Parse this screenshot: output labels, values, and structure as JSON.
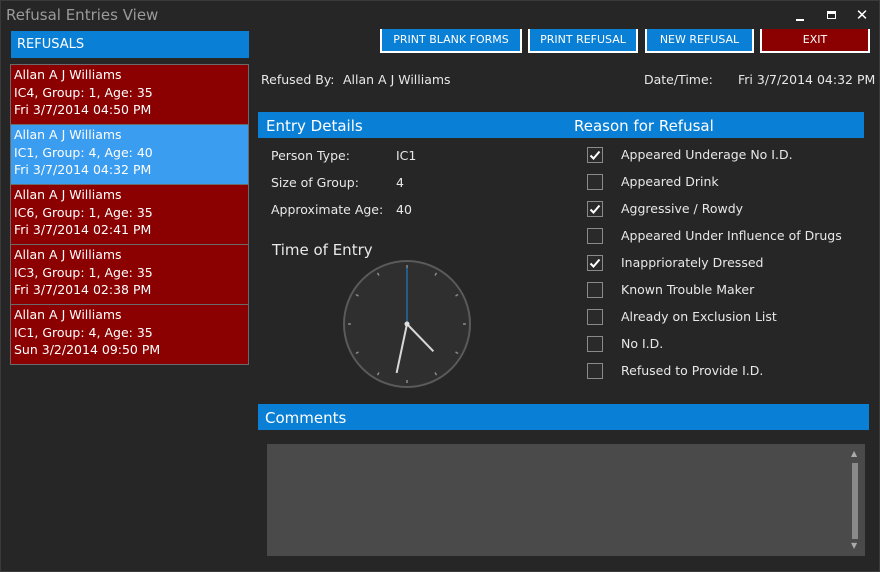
{
  "window": {
    "title": "Refusal Entries View",
    "minimize_glyph": "",
    "close_glyph": "✕"
  },
  "sidebar": {
    "header": "REFUSALS",
    "entries": [
      {
        "name": "Allan  A J Williams",
        "details": "IC4, Group: 1, Age: 35",
        "datetime": "Fri 3/7/2014  04:50 PM",
        "selected": false
      },
      {
        "name": "Allan  A J Williams",
        "details": "IC1, Group: 4, Age: 40",
        "datetime": "Fri 3/7/2014  04:32 PM",
        "selected": true
      },
      {
        "name": "Allan  A J Williams",
        "details": "IC6, Group: 1, Age: 35",
        "datetime": "Fri 3/7/2014  02:41 PM",
        "selected": false
      },
      {
        "name": "Allan  A J Williams",
        "details": "IC3, Group: 1, Age: 35",
        "datetime": "Fri 3/7/2014  02:38 PM",
        "selected": false
      },
      {
        "name": "Allan  A J Williams",
        "details": "IC1, Group: 4, Age: 35",
        "datetime": "Sun 3/2/2014  09:50 PM",
        "selected": false
      }
    ]
  },
  "toolbar": {
    "print_blank_forms": "PRINT BLANK FORMS",
    "print_refusal": "PRINT REFUSAL",
    "new_refusal": "NEW REFUSAL",
    "exit": "EXIT"
  },
  "summary": {
    "refused_by_label": "Refused By:",
    "refused_by_value": "Allan A J Williams",
    "datetime_label": "Date/Time:",
    "datetime_value": "Fri 3/7/2014 04:32 PM"
  },
  "entry_details": {
    "title": "Entry Details",
    "person_type_label": "Person Type:",
    "person_type_value": "IC1",
    "group_size_label": "Size of Group:",
    "group_size_value": "4",
    "age_label": "Approximate Age:",
    "age_value": "40"
  },
  "time_of_entry": {
    "title": "Time of Entry",
    "hour": 4,
    "minute": 32,
    "second": 0
  },
  "reason": {
    "title": "Reason for Refusal",
    "items": [
      {
        "label": "Appeared Underage No I.D.",
        "checked": true
      },
      {
        "label": "Appeared Drink",
        "checked": false
      },
      {
        "label": "Aggressive / Rowdy",
        "checked": true
      },
      {
        "label": "Appeared Under Influence of Drugs",
        "checked": false
      },
      {
        "label": "Inappriorately Dressed",
        "checked": true
      },
      {
        "label": "Known Trouble Maker",
        "checked": false
      },
      {
        "label": "Already on Exclusion List",
        "checked": false
      },
      {
        "label": "No I.D.",
        "checked": false
      },
      {
        "label": "Refused to Provide I.D.",
        "checked": false
      }
    ]
  },
  "comments": {
    "title": "Comments",
    "value": ""
  },
  "colors": {
    "accent": "#0a7fd6",
    "danger": "#8b0000",
    "selected": "#3b9df0",
    "background": "#262626"
  }
}
